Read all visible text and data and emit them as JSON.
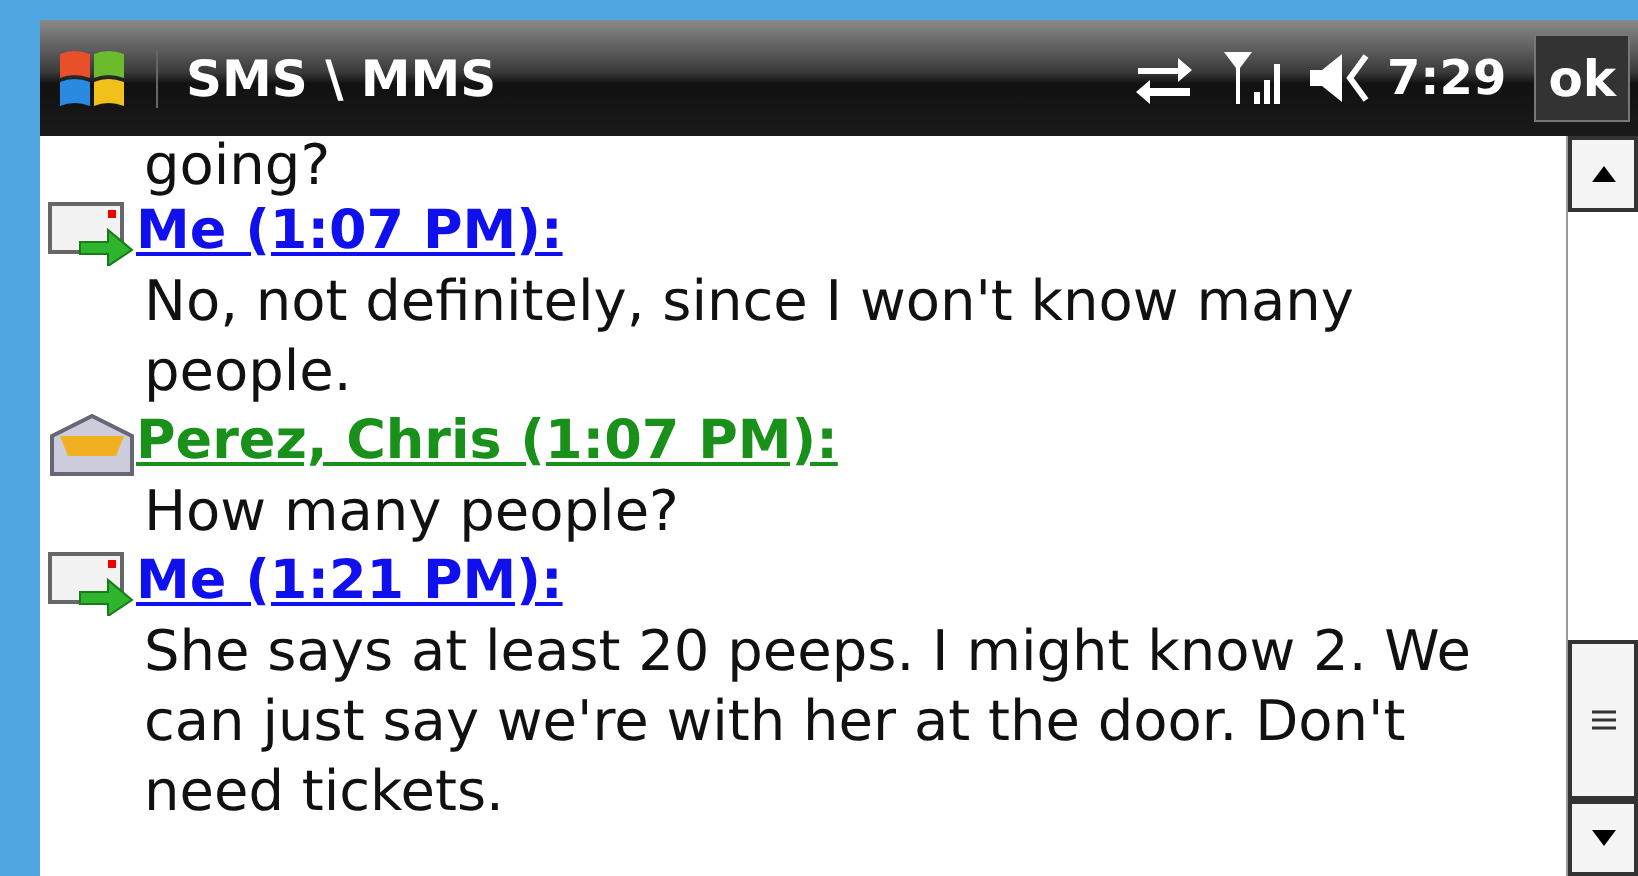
{
  "title_bar": {
    "title": "SMS \\ MMS",
    "time": "7:29",
    "ok_button": "ok"
  },
  "conversation": {
    "cut_line": "going?",
    "messages": [
      {
        "kind": "sent",
        "header": "Me (1:07 PM):",
        "body": "No, not definitely, since I won't know many people."
      },
      {
        "kind": "received",
        "header": "Perez, Chris (1:07 PM):",
        "body": "How many people?"
      },
      {
        "kind": "sent",
        "header": "Me (1:21 PM):",
        "body": "She says at least 20 peeps. I might know 2. We can just say we're with her at the door. Don't need tickets."
      }
    ]
  }
}
